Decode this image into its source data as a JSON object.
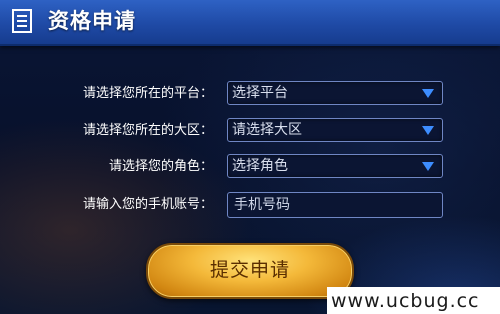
{
  "header": {
    "title": "资格申请",
    "icon": "document-list-icon"
  },
  "form": {
    "platform": {
      "label": "请选择您所在的平台：",
      "value": "选择平台"
    },
    "region": {
      "label": "请选择您所在的大区：",
      "value": "请选择大区"
    },
    "role": {
      "label": "请选择您的角色：",
      "value": "选择角色"
    },
    "phone": {
      "label": "请输入您的手机账号：",
      "placeholder": "手机号码"
    },
    "submit_label": "提交申请"
  },
  "watermark": {
    "text": "www.ucbug.cc"
  },
  "colors": {
    "header": "#1f4aa6",
    "field_border": "#6f86c4",
    "caret": "#3d8dff",
    "button_gold": "#f4b93a"
  }
}
